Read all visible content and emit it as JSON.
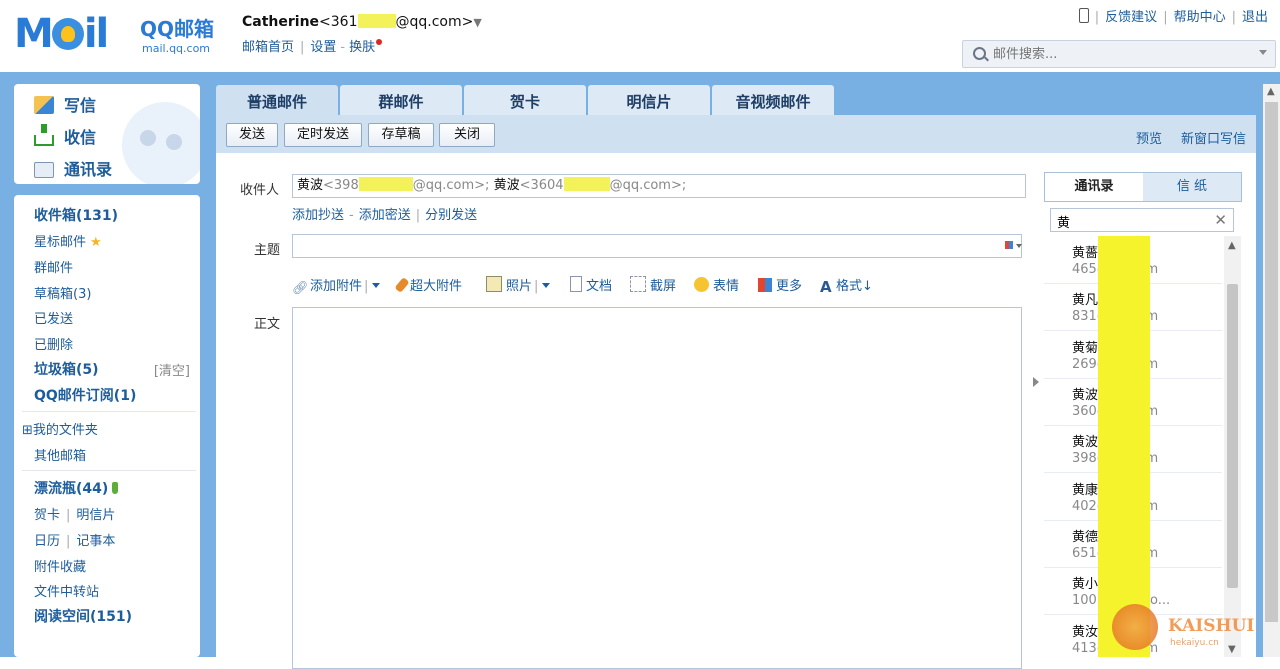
{
  "header": {
    "logo_text": "MOil",
    "brand": "QQ邮箱",
    "domain": "mail.qq.com",
    "account_name": "Catherine",
    "account_addr_prefix": "<361",
    "account_addr_suffix": "@qq.com>",
    "links": [
      "邮箱首页",
      "设置",
      "换肤"
    ],
    "top_links": [
      "反馈建议",
      "帮助中心",
      "退出"
    ],
    "search_placeholder": "邮件搜索..."
  },
  "sidebar": {
    "write": "写信",
    "inbox": "收信",
    "contacts": "通讯录",
    "folders": [
      {
        "label": "收件箱(131)",
        "bold": true
      },
      {
        "label": "星标邮件",
        "bold": false
      },
      {
        "label": "群邮件",
        "bold": false
      },
      {
        "label": "草稿箱(3)",
        "bold": false
      },
      {
        "label": "已发送",
        "bold": false
      },
      {
        "label": "已删除",
        "bold": false
      },
      {
        "label": "垃圾箱(5)",
        "bold": true
      },
      {
        "label": "QQ邮件订阅(1)",
        "bold": true
      }
    ],
    "clean": "[清空]",
    "my_folders": "⊞我的文件夹",
    "other_mailbox": "其他邮箱",
    "drift_bottle": "漂流瓶(44)",
    "cards": "贺卡",
    "postcard": "明信片",
    "calendar": "日历",
    "notepad": "记事本",
    "attachments": "附件收藏",
    "file_transfer": "文件中转站",
    "reading_space": "阅读空间(151)"
  },
  "tabs": [
    "普通邮件",
    "群邮件",
    "贺卡",
    "明信片",
    "音视频邮件"
  ],
  "toolbar": {
    "send": "发送",
    "scheduled_send": "定时发送",
    "save_draft": "存草稿",
    "close": "关闭",
    "preview": "预览",
    "new_window": "新窗口写信"
  },
  "compose": {
    "to_label": "收件人",
    "recipient1_name": "黄波",
    "recipient1_prefix": "<398",
    "recipient1_suffix": "@qq.com>;",
    "recipient2_name": "黄波",
    "recipient2_prefix": "<3604",
    "recipient2_suffix": "@qq.com>;",
    "add_cc": "添加抄送",
    "add_bcc": "添加密送",
    "separate_send": "分别发送",
    "subject_label": "主题",
    "body_label": "正文",
    "tools": {
      "attach": "添加附件",
      "big_attach": "超大附件",
      "photo": "照片",
      "doc": "文档",
      "screenshot": "截屏",
      "emoji": "表情",
      "more": "更多",
      "format": "格式↓"
    }
  },
  "contacts_panel": {
    "tab_contacts": "通讯录",
    "tab_stationery": "信 纸",
    "search_value": "黄",
    "items": [
      {
        "name": "黄薔",
        "email": "465@qq.com"
      },
      {
        "name": "黄凡 ~~~)",
        "email": "831@qq.com"
      },
      {
        "name": "黄菊 姑娘)",
        "email": "269@qq.com"
      },
      {
        "name": "黄波",
        "email": "360@qq.com"
      },
      {
        "name": "黄波",
        "email": "398@qq.com"
      },
      {
        "name": "黄康",
        "email": "402@qq.com"
      },
      {
        "name": "黄德",
        "email": "651@qq.com"
      },
      {
        "name": "黄小 )",
        "email": "100 0@qq.co..."
      },
      {
        "name": "黄汝 vence",
        "email": "413@qq.com"
      }
    ]
  },
  "watermark": {
    "text": "KAISHUI",
    "sub": "hekaiyu.cn"
  }
}
